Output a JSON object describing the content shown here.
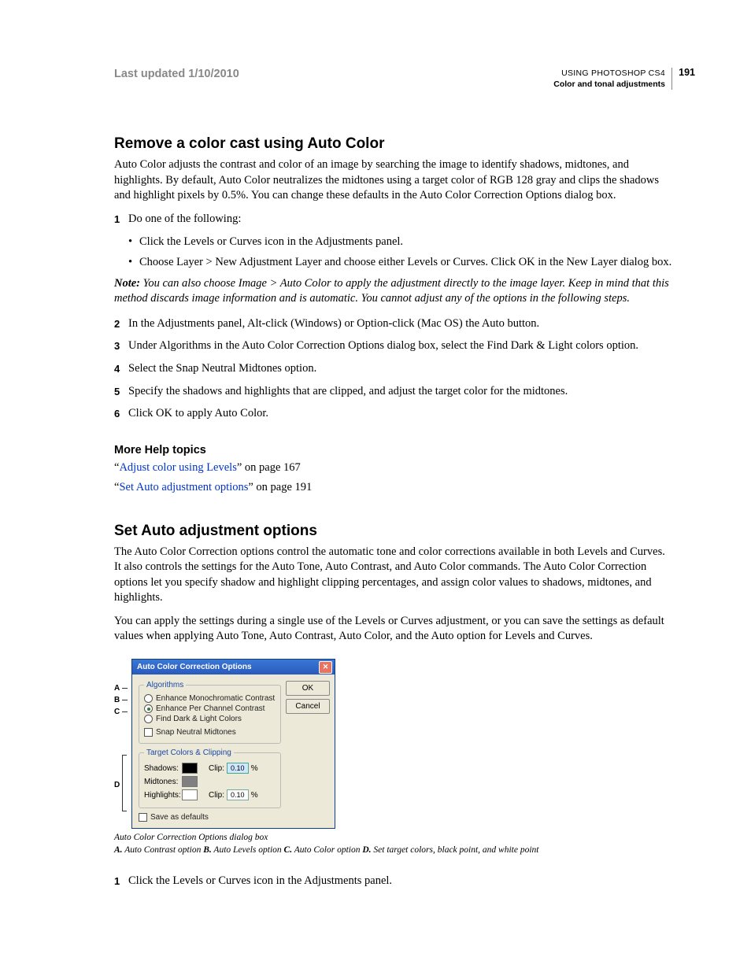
{
  "header": {
    "last_updated": "Last updated 1/10/2010",
    "doc_title": "USING PHOTOSHOP CS4",
    "section": "Color and tonal adjustments",
    "page_num": "191"
  },
  "sec1": {
    "heading": "Remove a color cast using Auto Color",
    "intro": "Auto Color adjusts the contrast and color of an image by searching the image to identify shadows, midtones, and highlights. By default, Auto Color neutralizes the midtones using a target color of RGB 128 gray and clips the shadows and highlight pixels by 0.5%. You can change these defaults in the Auto Color Correction Options dialog box.",
    "step1": "Do one of the following:",
    "bullet1": "Click the Levels or Curves icon in the Adjustments panel.",
    "bullet2": "Choose Layer > New Adjustment Layer and choose either Levels or Curves. Click OK in the New Layer dialog box.",
    "note_label": "Note:",
    "note": " You can also choose Image > Auto Color to apply the adjustment directly to the image layer. Keep in mind that this method discards image information and is automatic. You cannot adjust any of the options in the following steps.",
    "step2": "In the Adjustments panel, Alt-click (Windows) or Option-click (Mac OS) the Auto button.",
    "step3": "Under Algorithms in the Auto Color Correction Options dialog box, select the Find Dark & Light colors option.",
    "step4": "Select the Snap Neutral Midtones option.",
    "step5": "Specify the shadows and highlights that are clipped, and adjust the target color for the midtones.",
    "step6": "Click OK to apply Auto Color."
  },
  "more_help": {
    "heading": "More Help topics",
    "l1_q1": "“",
    "l1_link": "Adjust color using Levels",
    "l1_rest": "” on page 167",
    "l2_q1": "“",
    "l2_link": "Set Auto adjustment options",
    "l2_rest": "” on page 191"
  },
  "sec2": {
    "heading": "Set Auto adjustment options",
    "p1": "The Auto Color Correction options control the automatic tone and color corrections available in both Levels and Curves. It also controls the settings for the Auto Tone, Auto Contrast, and Auto Color commands. The Auto Color Correction options let you specify shadow and highlight clipping percentages, and assign color values to shadows, midtones, and highlights.",
    "p2": "You can apply the settings during a single use of the Levels or Curves adjustment, or you can save the settings as default values when applying Auto Tone, Auto Contrast, Auto Color, and the Auto option for Levels and Curves."
  },
  "dialog": {
    "title": "Auto Color Correction Options",
    "ok": "OK",
    "cancel": "Cancel",
    "fs1_legend": "Algorithms",
    "r1": "Enhance Monochromatic Contrast",
    "r2": "Enhance Per Channel Contrast",
    "r3": "Find Dark & Light Colors",
    "c1": "Snap Neutral Midtones",
    "fs2_legend": "Target Colors & Clipping",
    "shadows": "Shadows:",
    "midtones": "Midtones:",
    "highlights": "Highlights:",
    "clip": "Clip:",
    "clipval": "0.10",
    "pct": "%",
    "save": "Save as defaults"
  },
  "labels": {
    "A": "A",
    "B": "B",
    "C": "C",
    "D": "D"
  },
  "caption": {
    "line1": "Auto Color Correction Options dialog box",
    "A": "A.",
    "At": " Auto Contrast option  ",
    "B": "B.",
    "Bt": " Auto Levels option  ",
    "C": "C.",
    "Ct": " Auto Color option  ",
    "D": "D.",
    "Dt": " Set target colors, black point, and white point"
  },
  "sec2b": {
    "step1": "Click the Levels or Curves icon in the Adjustments panel."
  }
}
